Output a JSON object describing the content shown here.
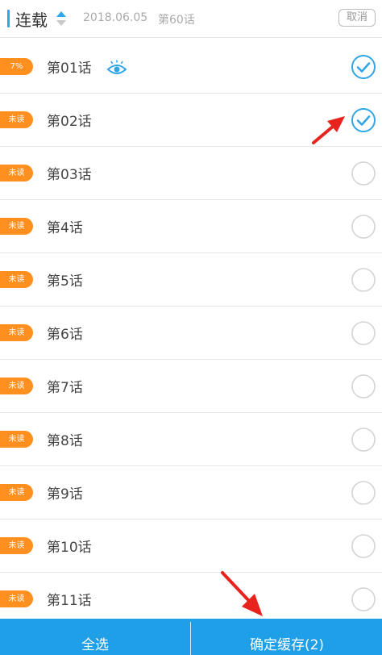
{
  "header": {
    "title": "连载",
    "date": "2018.06.05",
    "latest": "第60话",
    "cancel_label": "取消"
  },
  "chapters": [
    {
      "title": "第01话",
      "badge": "7%",
      "progress_percent": 7,
      "checked": true,
      "reading": true
    },
    {
      "title": "第02话",
      "badge": "未读",
      "checked": true
    },
    {
      "title": "第03话",
      "badge": "未读",
      "checked": false
    },
    {
      "title": "第4话",
      "badge": "未读",
      "checked": false
    },
    {
      "title": "第5话",
      "badge": "未读",
      "checked": false
    },
    {
      "title": "第6话",
      "badge": "未读",
      "checked": false
    },
    {
      "title": "第7话",
      "badge": "未读",
      "checked": false
    },
    {
      "title": "第8话",
      "badge": "未读",
      "checked": false
    },
    {
      "title": "第9话",
      "badge": "未读",
      "checked": false
    },
    {
      "title": "第10话",
      "badge": "未读",
      "checked": false
    },
    {
      "title": "第11话",
      "badge": "未读",
      "checked": false
    }
  ],
  "footer": {
    "select_all_label": "全选",
    "confirm_label": "确定缓存(2)"
  },
  "icons": {
    "sort": "sort-icon",
    "eye": "eye-icon",
    "checked": "check-circle-icon",
    "unchecked": "empty-circle-icon"
  },
  "colors": {
    "accent": "#2fa6e8",
    "badge": "#ff8f1f",
    "footer": "#1f9fe8",
    "annotation_arrow": "#e8231e"
  }
}
